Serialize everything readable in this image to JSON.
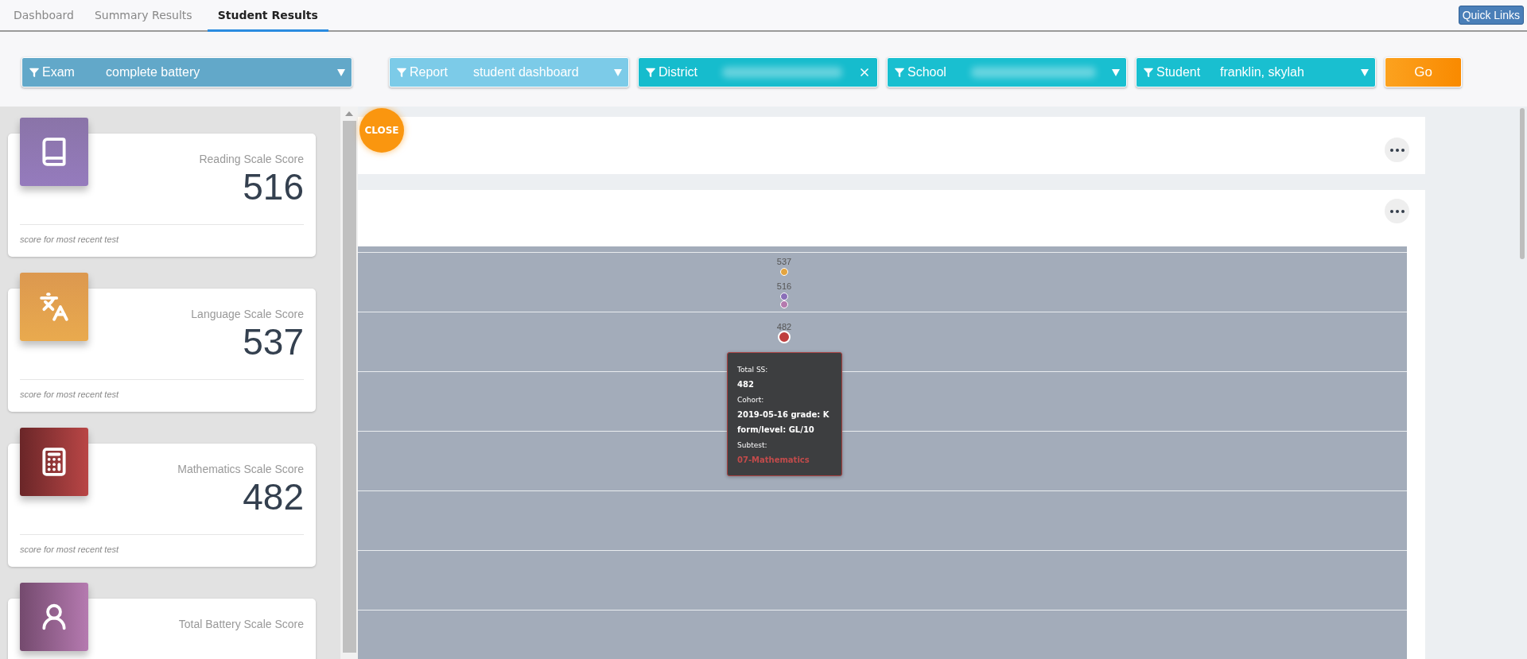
{
  "tabs": [
    {
      "label": "Dashboard",
      "selected": false
    },
    {
      "label": "Summary Results",
      "selected": false
    },
    {
      "label": "Student Results",
      "selected": true
    }
  ],
  "quick_links": "Quick Links",
  "filters": [
    {
      "label": "Exam",
      "value": "complete battery",
      "kind": "select",
      "color": "#62a8c9",
      "redacted": false
    },
    {
      "label": "Report",
      "value": "student dashboard",
      "kind": "select",
      "color": "#7ccbe8",
      "redacted": false
    },
    {
      "label": "District",
      "kind": "clearable",
      "color": "#16bccd",
      "redacted": true
    },
    {
      "label": "School",
      "kind": "select",
      "color": "#19bfd0",
      "redacted": true
    },
    {
      "label": "Student",
      "value": "franklin, skylah",
      "kind": "select",
      "color": "#19bfd0",
      "redacted": false
    }
  ],
  "go_button": "Go",
  "score_cards": [
    {
      "kind": "book",
      "title": "Reading Scale Score",
      "value": "516",
      "note": "score for most recent test"
    },
    {
      "kind": "language",
      "title": "Language Scale Score",
      "value": "537",
      "note": "score for most recent test"
    },
    {
      "kind": "calculator",
      "title": "Mathematics Scale Score",
      "value": "482",
      "note": "score for most recent test"
    },
    {
      "kind": "person",
      "title": "Total Battery Scale Score"
    }
  ],
  "close_button": "CLOSE",
  "chart_points": [
    {
      "label": "537",
      "color": "#e3a43f",
      "selected": false
    },
    {
      "label": "516",
      "color": "#8a6fb8",
      "selected": false
    },
    {
      "color": "#b47aae",
      "selected": false
    },
    {
      "label": "482",
      "color": "#bf3f3f",
      "selected": true
    }
  ],
  "tooltip": [
    {
      "heading": "Total SS:",
      "lines": [
        "482"
      ],
      "accent": false
    },
    {
      "heading": "Cohort:",
      "lines": [
        "2019-05-16 grade: K",
        "form/level: GL/10"
      ],
      "accent": false
    },
    {
      "heading": "Subtest:",
      "lines": [
        "07-Mathematics"
      ],
      "accent": true
    }
  ]
}
